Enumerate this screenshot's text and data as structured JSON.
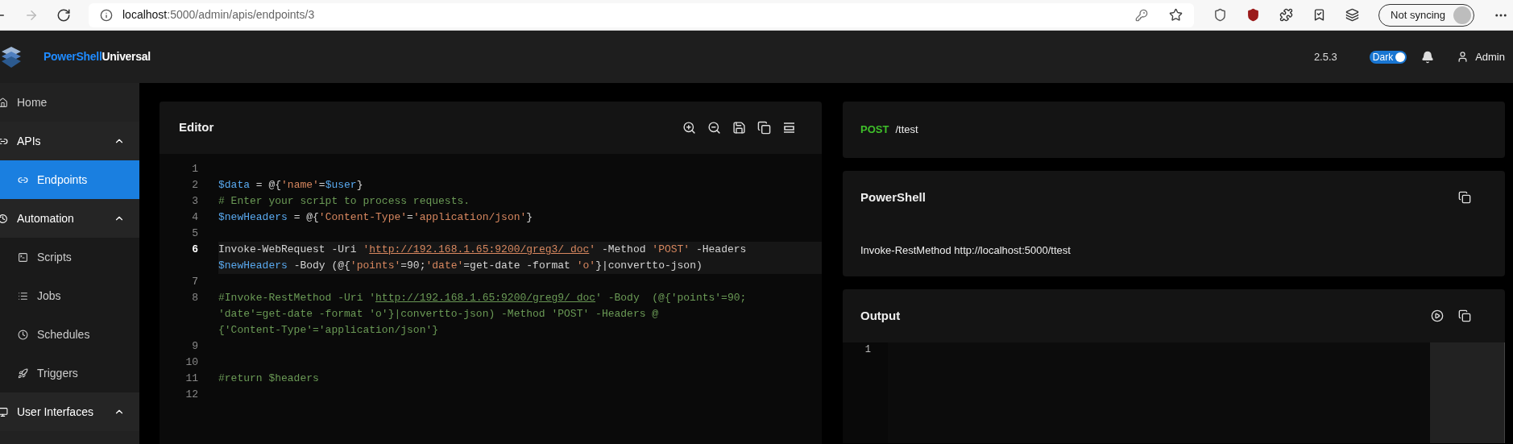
{
  "browser": {
    "url_host": "localhost",
    "url_path": ":5000/admin/apis/endpoints/3",
    "sync_label": "Not syncing",
    "forward_disabled": true
  },
  "header": {
    "brand_first": "PowerShell",
    "brand_second": "Universal",
    "version": "2.5.3",
    "theme_label": "Dark",
    "theme_on": true,
    "user": "Admin"
  },
  "sidebar": {
    "items": [
      {
        "label": "Home"
      },
      {
        "label": "APIs",
        "expanded": true,
        "children": [
          {
            "label": "Endpoints",
            "selected": true
          }
        ]
      },
      {
        "label": "Automation",
        "expanded": true,
        "children": [
          {
            "label": "Scripts",
            "selected": false
          },
          {
            "label": "Jobs",
            "selected": false
          },
          {
            "label": "Schedules",
            "selected": false
          },
          {
            "label": "Triggers",
            "selected": false
          }
        ]
      },
      {
        "label": "User Interfaces",
        "expanded": true
      }
    ]
  },
  "editor": {
    "title": "Editor",
    "lines": [
      {
        "number": "1",
        "current": false
      },
      {
        "number": "2",
        "current": false,
        "wrapped": [
          {
            "spans": [
              {
                "text": "$data",
                "kind": "var"
              },
              {
                "text": " = @{",
                "kind": "plain"
              },
              {
                "text": "'name'",
                "kind": "str"
              },
              {
                "text": "=",
                "kind": "plain"
              },
              {
                "text": "$user",
                "kind": "var"
              },
              {
                "text": "}",
                "kind": "plain"
              }
            ]
          }
        ]
      },
      {
        "number": "3",
        "current": false,
        "wrapped": [
          {
            "spans": [
              {
                "text": "# Enter your script to process requests.",
                "kind": "comment"
              }
            ]
          }
        ]
      },
      {
        "number": "4",
        "current": false,
        "wrapped": [
          {
            "spans": [
              {
                "text": "$newHeaders",
                "kind": "var"
              },
              {
                "text": " = @{",
                "kind": "plain"
              },
              {
                "text": "'Content-Type'",
                "kind": "str"
              },
              {
                "text": "=",
                "kind": "plain"
              },
              {
                "text": "'application/json'",
                "kind": "str"
              },
              {
                "text": "}",
                "kind": "plain"
              }
            ]
          }
        ]
      },
      {
        "number": "5",
        "current": false
      },
      {
        "number": "6",
        "current": true,
        "wrapped": [
          {
            "spans": [
              {
                "text": "Invoke-WebRequest -Uri ",
                "kind": "plain"
              },
              {
                "text": "'",
                "kind": "str"
              },
              {
                "text": "http://192.168.1.65:9200/greg3/_doc",
                "kind": "link"
              },
              {
                "text": "'",
                "kind": "str"
              },
              {
                "text": " -Method ",
                "kind": "plain"
              },
              {
                "text": "'POST'",
                "kind": "str"
              },
              {
                "text": " -Headers",
                "kind": "plain"
              }
            ]
          },
          {
            "spans": [
              {
                "text": "$newHeaders",
                "kind": "var"
              },
              {
                "text": " -Body (@{",
                "kind": "plain"
              },
              {
                "text": "'points'",
                "kind": "str"
              },
              {
                "text": "=90;",
                "kind": "plain"
              },
              {
                "text": "'date'",
                "kind": "str"
              },
              {
                "text": "=get-date -format ",
                "kind": "plain"
              },
              {
                "text": "'o'",
                "kind": "str"
              },
              {
                "text": "}|convertto-json)",
                "kind": "plain"
              }
            ]
          }
        ]
      },
      {
        "number": "7",
        "current": false
      },
      {
        "number": "8",
        "current": false,
        "wrapped": [
          {
            "spans": [
              {
                "text": "#Invoke-RestMethod -Uri '",
                "kind": "comment"
              },
              {
                "text": "http://192.168.1.65:9200/greg9/_doc",
                "kind": "comment_link"
              },
              {
                "text": "' -Body  (@{'points'=90;",
                "kind": "comment"
              }
            ]
          },
          {
            "spans": [
              {
                "text": "'date'=get-date -format 'o'}|convertto-json) -Method 'POST' -Headers @",
                "kind": "comment"
              }
            ]
          },
          {
            "spans": [
              {
                "text": "{'Content-Type'='application/json'}",
                "kind": "comment"
              }
            ]
          }
        ]
      },
      {
        "number": "9",
        "current": false
      },
      {
        "number": "10",
        "current": false
      },
      {
        "number": "11",
        "current": false,
        "wrapped": [
          {
            "spans": [
              {
                "text": "#return $headers",
                "kind": "comment"
              }
            ]
          }
        ]
      },
      {
        "number": "12",
        "current": false
      }
    ]
  },
  "endpoint": {
    "method": "POST",
    "path": "/ttest"
  },
  "powershell": {
    "title": "PowerShell",
    "command": "Invoke-RestMethod http://localhost:5000/ttest"
  },
  "output": {
    "title": "Output",
    "lines": [
      "1"
    ]
  }
}
